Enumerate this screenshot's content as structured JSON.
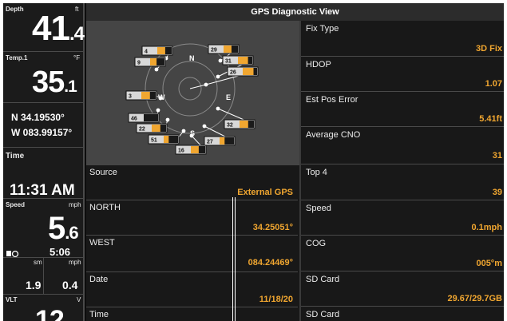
{
  "left": {
    "depth_label": "Depth",
    "depth_unit": "ft",
    "depth_int": "41",
    "depth_dec": ".4",
    "temp_label": "Temp.1",
    "temp_unit": "°F",
    "temp_int": "35",
    "temp_dec": ".1",
    "lat": "N 34.19530°",
    "lon": "W 083.99157°",
    "time_label": "Time",
    "time_value": "11:31 AM",
    "speed_label": "Speed",
    "speed_unit": "mph",
    "speed_int": "5",
    "speed_dec": ".6",
    "timer_value": "5:06",
    "sm_label": "sm",
    "mph_label": "mph",
    "trip_distance": "1.9",
    "trip_speed": "0.4",
    "vlt_label": "VLT",
    "vlt_unit": "V",
    "vlt_value": "12"
  },
  "header": {
    "title": "GPS Diagnostic View"
  },
  "sky": {
    "compass": {
      "n": "N",
      "e": "E",
      "s": "S",
      "w": "W"
    },
    "satellites": [
      {
        "id": "4",
        "strength": 0.55
      },
      {
        "id": "9",
        "strength": 0.45
      },
      {
        "id": "29",
        "strength": 0.55
      },
      {
        "id": "31",
        "strength": 0.7
      },
      {
        "id": "26",
        "strength": 0.75
      },
      {
        "id": "3",
        "strength": 0.6
      },
      {
        "id": "46",
        "strength": 0.0
      },
      {
        "id": "22",
        "strength": 0.6
      },
      {
        "id": "32",
        "strength": 0.6
      },
      {
        "id": "51",
        "strength": 0.35
      },
      {
        "id": "27",
        "strength": 0.35
      },
      {
        "id": "16",
        "strength": 0.55
      }
    ]
  },
  "info": [
    {
      "label": "Source",
      "value": "External GPS"
    },
    {
      "label": "NORTH",
      "value": "34.25051°"
    },
    {
      "label": "WEST",
      "value": "084.24469°"
    },
    {
      "label": "Date",
      "value": "11/18/20"
    },
    {
      "label": "Time",
      "value": ""
    }
  ],
  "right": [
    {
      "label": "Fix Type",
      "value": "3D Fix"
    },
    {
      "label": "HDOP",
      "value": "1.07"
    },
    {
      "label": "Est Pos Error",
      "value": "5.41ft"
    },
    {
      "label": "Average CNO",
      "value": "31"
    },
    {
      "label": "Top 4",
      "value": "39"
    },
    {
      "label": "Speed",
      "value": "0.1mph"
    },
    {
      "label": "COG",
      "value": "005°m"
    },
    {
      "label": "SD Card",
      "value": "29.67/29.7GB"
    },
    {
      "label": "SD Card",
      "value": ""
    }
  ],
  "colors": {
    "accent": "#f0a630",
    "panel": "#181818",
    "sky": "#454545"
  }
}
